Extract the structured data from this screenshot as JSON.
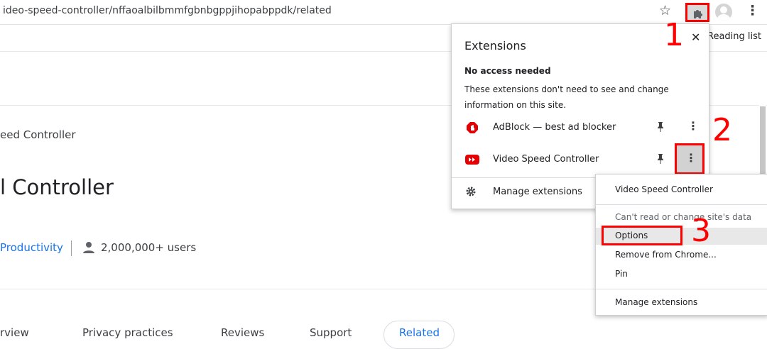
{
  "toolbar": {
    "url": "ideo-speed-controller/nffaoalbilbmmfgbnbgppjihopabppdk/related",
    "star_icon": "star-icon",
    "extensions_icon": "puzzle-icon",
    "menu_icon": "kebab-icon"
  },
  "bookmarks": {
    "reading_list": "Reading list"
  },
  "page": {
    "subtitle": "eed Controller",
    "title": "l Controller",
    "category": "Productivity",
    "users": "2,000,000+ users",
    "tabs": [
      {
        "label": "rview"
      },
      {
        "label": "Privacy practices"
      },
      {
        "label": "Reviews"
      },
      {
        "label": "Support"
      },
      {
        "label": "Related"
      }
    ]
  },
  "popup": {
    "title": "Extensions",
    "close": "✕",
    "section_title": "No access needed",
    "section_desc": "These extensions don't need to see and change information on this site.",
    "extensions": [
      {
        "name": "AdBlock — best ad blocker",
        "icon": "adblock-icon"
      },
      {
        "name": "Video Speed Controller",
        "icon": "youtube-icon"
      }
    ],
    "more": "⋮",
    "manage": "Manage extensions"
  },
  "context_menu": {
    "header": "Video Speed Controller",
    "cant_read": "Can't read or change site's data",
    "options": "Options",
    "remove": "Remove from Chrome...",
    "pin": "Pin",
    "manage": "Manage extensions"
  },
  "annotations": {
    "n1": "1",
    "n2": "2",
    "n3": "3"
  },
  "colors": {
    "highlight": "#ff0000",
    "link": "#1a73e8"
  }
}
